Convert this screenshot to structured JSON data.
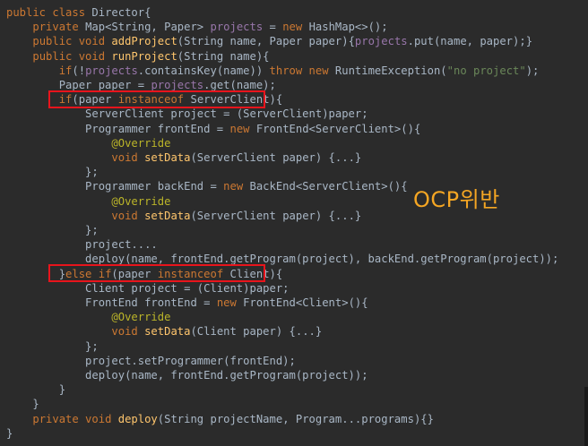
{
  "editor": {
    "annotation_text": "OCP위반",
    "colors": {
      "background": "#2b2b2b",
      "keyword": "#cc7832",
      "function": "#ffc66d",
      "field": "#9876aa",
      "string": "#6a8759",
      "annotation": "#bbb529",
      "plain": "#a9b7c6",
      "highlight_box": "#e8141c",
      "note": "#f5a623"
    },
    "lines": [
      [
        [
          "kw",
          "public class "
        ],
        [
          "plain",
          "Director{"
        ]
      ],
      [
        [
          "plain",
          "    "
        ],
        [
          "kw",
          "private "
        ],
        [
          "plain",
          "Map<String, Paper> "
        ],
        [
          "field",
          "projects"
        ],
        [
          "plain",
          " = "
        ],
        [
          "kw",
          "new "
        ],
        [
          "plain",
          "HashMap<>();"
        ]
      ],
      [
        [
          "plain",
          "    "
        ],
        [
          "kw",
          "public void "
        ],
        [
          "fn",
          "addProject"
        ],
        [
          "plain",
          "(String name, Paper paper){"
        ],
        [
          "field",
          "projects"
        ],
        [
          "plain",
          ".put(name, paper);}"
        ]
      ],
      [
        [
          "plain",
          "    "
        ],
        [
          "kw",
          "public void "
        ],
        [
          "fn",
          "runProject"
        ],
        [
          "plain",
          "(String name){"
        ]
      ],
      [
        [
          "plain",
          "        "
        ],
        [
          "kw",
          "if"
        ],
        [
          "plain",
          "(!"
        ],
        [
          "field",
          "projects"
        ],
        [
          "plain",
          ".containsKey(name)) "
        ],
        [
          "kw",
          "throw new "
        ],
        [
          "plain",
          "RuntimeException("
        ],
        [
          "str",
          "\"no project\""
        ],
        [
          "plain",
          ");"
        ]
      ],
      [
        [
          "plain",
          "        Paper paper = "
        ],
        [
          "field",
          "projects"
        ],
        [
          "plain",
          ".get(name);"
        ]
      ],
      [
        [
          "plain",
          "        "
        ],
        [
          "kw",
          "if"
        ],
        [
          "plain",
          "(paper "
        ],
        [
          "kw",
          "instanceof "
        ],
        [
          "plain",
          "ServerClient){"
        ]
      ],
      [
        [
          "plain",
          "            ServerClient project = (ServerClient)paper;"
        ]
      ],
      [
        [
          "plain",
          "            Programmer frontEnd = "
        ],
        [
          "kw",
          "new "
        ],
        [
          "plain",
          "FrontEnd<ServerClient>(){"
        ]
      ],
      [
        [
          "plain",
          "                "
        ],
        [
          "ann",
          "@Override"
        ]
      ],
      [
        [
          "plain",
          "                "
        ],
        [
          "kw",
          "void "
        ],
        [
          "fn",
          "setData"
        ],
        [
          "plain",
          "(ServerClient paper) {...}"
        ]
      ],
      [
        [
          "plain",
          "            };"
        ]
      ],
      [
        [
          "plain",
          "            Programmer backEnd = "
        ],
        [
          "kw",
          "new "
        ],
        [
          "plain",
          "BackEnd<ServerClient>(){"
        ]
      ],
      [
        [
          "plain",
          "                "
        ],
        [
          "ann",
          "@Override"
        ]
      ],
      [
        [
          "plain",
          "                "
        ],
        [
          "kw",
          "void "
        ],
        [
          "fn",
          "setData"
        ],
        [
          "plain",
          "(ServerClient paper) {...}"
        ]
      ],
      [
        [
          "plain",
          "            };"
        ]
      ],
      [
        [
          "plain",
          "            project...."
        ]
      ],
      [
        [
          "plain",
          "            deploy(name, frontEnd.getProgram(project), backEnd.getProgram(project));"
        ]
      ],
      [
        [
          "plain",
          "        }"
        ],
        [
          "kw",
          "else if"
        ],
        [
          "plain",
          "(paper "
        ],
        [
          "kw",
          "instanceof "
        ],
        [
          "plain",
          "Client){"
        ]
      ],
      [
        [
          "plain",
          "            Client project = (Client)paper;"
        ]
      ],
      [
        [
          "plain",
          "            FrontEnd frontEnd = "
        ],
        [
          "kw",
          "new "
        ],
        [
          "plain",
          "FrontEnd<Client>(){"
        ]
      ],
      [
        [
          "plain",
          "                "
        ],
        [
          "ann",
          "@Override"
        ]
      ],
      [
        [
          "plain",
          "                "
        ],
        [
          "kw",
          "void "
        ],
        [
          "fn",
          "setData"
        ],
        [
          "plain",
          "(Client paper) {...}"
        ]
      ],
      [
        [
          "plain",
          "            };"
        ]
      ],
      [
        [
          "plain",
          "            project.setProgrammer(frontEnd);"
        ]
      ],
      [
        [
          "plain",
          "            deploy(name, frontEnd.getProgram(project));"
        ]
      ],
      [
        [
          "plain",
          "        }"
        ]
      ],
      [
        [
          "plain",
          "    }"
        ]
      ],
      [
        [
          "plain",
          "    "
        ],
        [
          "kw",
          "private void "
        ],
        [
          "fn",
          "deploy"
        ],
        [
          "plain",
          "(String projectName, Program...programs){}"
        ]
      ],
      [
        [
          "plain",
          "}"
        ]
      ]
    ]
  }
}
